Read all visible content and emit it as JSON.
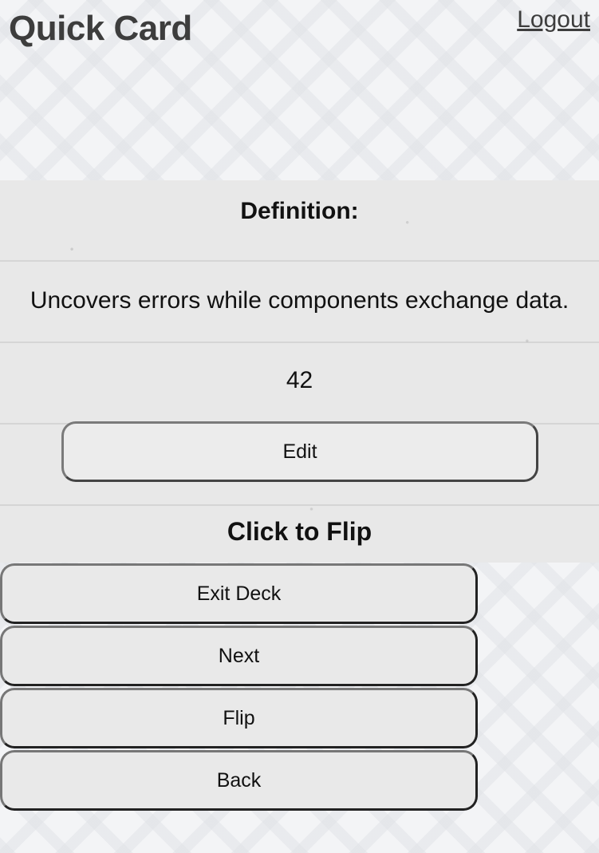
{
  "header": {
    "title": "Quick Card",
    "logout_label": "Logout"
  },
  "card": {
    "heading": "Definition:",
    "text": "Uncovers errors while components exchange data.",
    "count": "42",
    "edit_label": "Edit",
    "flip_hint": "Click to Flip"
  },
  "controls": {
    "exit_label": "Exit Deck",
    "next_label": "Next",
    "flip_label": "Flip",
    "back_label": "Back"
  }
}
